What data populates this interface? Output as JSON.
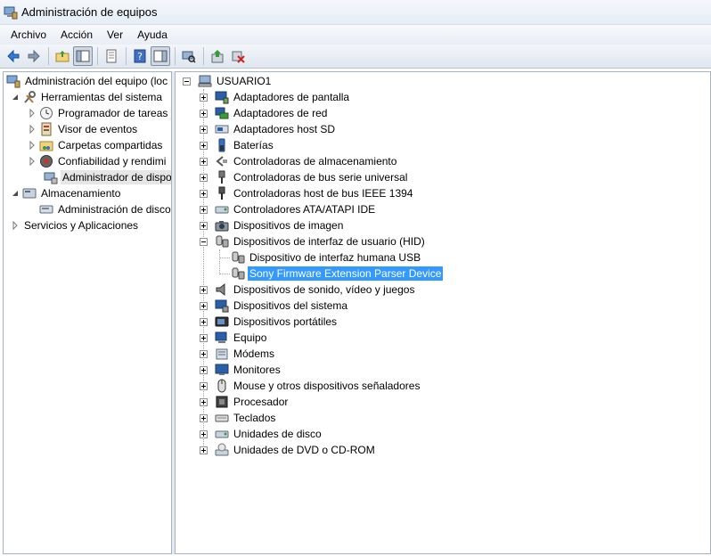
{
  "window": {
    "title": "Administración de equipos"
  },
  "menu": [
    "Archivo",
    "Acción",
    "Ver",
    "Ayuda"
  ],
  "left_tree": {
    "root": "Administración del equipo (loc",
    "tools": "Herramientas del sistema",
    "task_scheduler": "Programador de tareas",
    "event_viewer": "Visor de eventos",
    "shared_folders": "Carpetas compartidas",
    "reliability": "Confiabilidad y rendimi",
    "device_manager": "Administrador de dispo",
    "storage": "Almacenamiento",
    "disk_mgmt": "Administración de disco",
    "services": "Servicios y Aplicaciones"
  },
  "device_tree": {
    "computer": "USUARIO1",
    "categories": [
      "Adaptadores de pantalla",
      "Adaptadores de red",
      "Adaptadores host SD",
      "Baterías",
      "Controladoras de almacenamiento",
      "Controladoras de bus serie universal",
      "Controladoras host de bus IEEE 1394",
      "Controladores ATA/ATAPI IDE",
      "Dispositivos de imagen",
      "Dispositivos de interfaz de usuario (HID)"
    ],
    "hid_children": [
      "Dispositivo de interfaz humana USB",
      "Sony Firmware Extension Parser Device"
    ],
    "categories_after": [
      "Dispositivos de sonido, vídeo y juegos",
      "Dispositivos del sistema",
      "Dispositivos portátiles",
      "Equipo",
      "Módems",
      "Monitores",
      "Mouse y otros dispositivos señaladores",
      "Procesador",
      "Teclados",
      "Unidades de disco",
      "Unidades de DVD o CD-ROM"
    ]
  },
  "colors": {
    "selection": "#3399ff",
    "accent": "#1c6fd1"
  }
}
